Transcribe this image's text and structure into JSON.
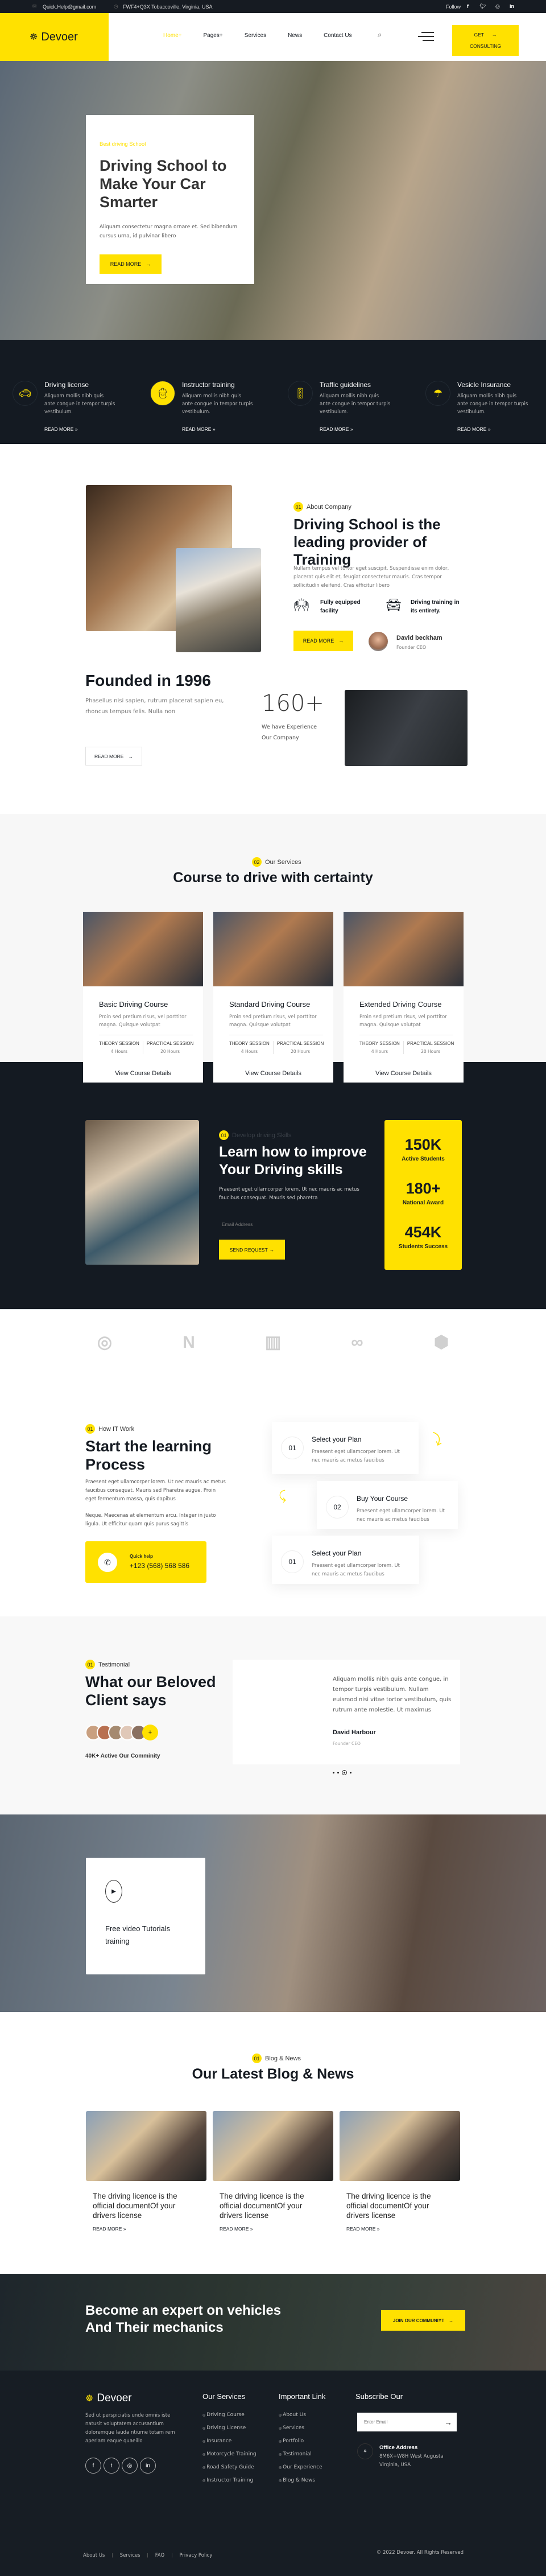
{
  "colors": {
    "accent": "#ffe100",
    "dark": "#141a22"
  },
  "topbar": {
    "email": "Quick.Help@gmail.com",
    "address": "FWF4+Q3X Tobaccoville, Virginia, USA",
    "follow": "Follow",
    "socials": [
      "facebook-icon",
      "twitter-icon",
      "instagram-icon",
      "linkedin-icon"
    ]
  },
  "header": {
    "logo": "Devoer",
    "nav": [
      {
        "label": "Home+",
        "active": true
      },
      {
        "label": "Pages+"
      },
      {
        "label": "Services"
      },
      {
        "label": "News"
      },
      {
        "label": "Contact Us"
      }
    ],
    "cta_line1": "GET",
    "cta_line2": "CONSULTING"
  },
  "hero": {
    "tag": "Best driving School",
    "title": "Driving School to Make Your Car Smarter",
    "text": "Aliquam consectetur magna ornare et. Sed bibendum cursus urna, id pulvinar libero",
    "button": "READ MORE"
  },
  "features": [
    {
      "title": "Driving license",
      "text": "Aliquam mollis nibh quis ante congue in tempor turpis vestibulum.",
      "link": "READ MORE",
      "icon": "car-license-icon"
    },
    {
      "title": "Instructor training",
      "text": "Aliquam mollis nibh quis ante congue in tempor turpis vestibulum.",
      "link": "READ MORE",
      "icon": "instructor-icon",
      "active": true
    },
    {
      "title": "Traffic guidelines",
      "text": "Aliquam mollis nibh quis ante congue in tempor turpis vestibulum.",
      "link": "READ MORE",
      "icon": "traffic-light-icon"
    },
    {
      "title": "Vesicle Insurance",
      "text": "Aliquam mollis nibh quis ante congue in tempor turpis vestibulum.",
      "link": "READ MORE",
      "icon": "insurance-umbrella-icon"
    }
  ],
  "about": {
    "badge_num": "01",
    "badge": "About Company",
    "title": "Driving School is the leading provider of Training",
    "text": "Nullam tempus vel tortor eget suscipit. Suspendisse enim dolor, placerat quis elit et, feugiat consectetur mauris. Cras tempor sollicitudin eleifend. Cras efficitur libero",
    "point1": "Fully equipped facility",
    "point2": "Driving training in its entirety.",
    "button": "READ MORE",
    "founder_name": "David beckham",
    "founder_role": "Founder CEO"
  },
  "founded": {
    "title": "Founded in 1996",
    "text": "Phasellus nisi sapien, rutrum placerat sapien eu, rhoncus tempus felis. Nulla non",
    "button": "READ MORE",
    "stat": "160+",
    "stat_label": "We have Experience Our Company"
  },
  "services": {
    "badge_num": "02",
    "badge": "Our Services",
    "title": "Course to drive with certainty",
    "courses": [
      {
        "title": "Basic Driving Course",
        "text": "Proin sed pretium risus, vel porttitor magna. Quisque volutpat",
        "theory": "THEORY SESSION",
        "theory_val": "4 Hours",
        "practical": "PRACTICAL SESSION",
        "practical_val": "20 Hours",
        "link": "View Course Details"
      },
      {
        "title": "Standard Driving Course",
        "text": "Proin sed pretium risus, vel porttitor magna. Quisque volutpat",
        "theory": "THEORY SESSION",
        "theory_val": "4 Hours",
        "practical": "PRACTICAL SESSION",
        "practical_val": "20 Hours",
        "link": "View Course Details"
      },
      {
        "title": "Extended Driving Course",
        "text": "Proin sed pretium risus, vel porttitor magna. Quisque volutpat",
        "theory": "THEORY SESSION",
        "theory_val": "4 Hours",
        "practical": "PRACTICAL SESSION",
        "practical_val": "20 Hours",
        "link": "View Course Details"
      }
    ]
  },
  "skills": {
    "badge_num": "01",
    "badge": "Develop driving Skills",
    "title": "Learn how to improve Your Driving skills",
    "text": "Praesent eget ullamcorper lorem. Ut nec mauris ac metus faucibus consequat. Mauris sed pharetra",
    "email_placeholder": "Email Address",
    "button": "SEND REQUEST",
    "stats": [
      {
        "value": "150K",
        "label": "Active Students"
      },
      {
        "value": "180+",
        "label": "National Award"
      },
      {
        "value": "454K",
        "label": "Students Success"
      }
    ]
  },
  "how": {
    "badge_num": "01",
    "badge": "How IT Work",
    "title": "Start the learning Process",
    "text1": "Praesent eget ullamcorper lorem. Ut nec mauris ac metus faucibus consequat. Mauris sed Pharetra augue. Proin eget fermentum massa, quis dapibus",
    "text2": "Neque. Maecenas at elementum arcu. Integer in justo ligula. Ut efficitur quam quis purus sagittis",
    "help_label": "Quick help",
    "phone": "+123 (568) 568 586",
    "steps": [
      {
        "num": "01",
        "title": "Select your Plan",
        "text": "Praesent eget ullamcorper lorem. Ut nec mauris ac metus faucibus"
      },
      {
        "num": "02",
        "title": "Buy Your Course",
        "text": "Praesent eget ullamcorper lorem. Ut nec mauris ac metus faucibus"
      },
      {
        "num": "01",
        "title": "Select your Plan",
        "text": "Praesent eget ullamcorper lorem. Ut nec mauris ac metus faucibus"
      }
    ]
  },
  "testimonial": {
    "badge_num": "01",
    "badge": "Testimonial",
    "title": "What our Beloved Client says",
    "community": "40K+ Active Our Comminity",
    "plus": "+",
    "quote": "Aliquam mollis nibh quis ante congue, in tempor turpis vestibulum. Nullam euismod nisi vitae tortor vestibulum, quis rutrum ante molestie. Ut maximus",
    "name": "David Harbour",
    "role": "Founder CEO",
    "slides": 4,
    "active_slide": 3
  },
  "video": {
    "title": "Free video Tutorials training"
  },
  "blog": {
    "badge_num": "01",
    "badge": "Blog & News",
    "title": "Our Latest Blog & News",
    "posts": [
      {
        "title": "The driving licence is the official documentOf your drivers license",
        "link": "READ MORE"
      },
      {
        "title": "The driving licence is the official documentOf your drivers license",
        "link": "READ MORE"
      },
      {
        "title": "The driving licence is the official documentOf your drivers license",
        "link": "READ MORE"
      }
    ]
  },
  "cta": {
    "title": "Become an expert on vehicles And Their mechanics",
    "button": "JOIN OUR COMMUNIYT"
  },
  "footer": {
    "logo": "Devoer",
    "about": "Sed ut perspiciatis unde omnis iste natusit voluptatem accusantium doloremque lauda ntiume totam rem aperiam eaque quaeillo",
    "services_title": "Our Services",
    "services": [
      "Driving Course",
      "Driving License",
      "Insurance",
      "Motorcycle Training",
      "Road Safety Guide",
      "Instructor Training"
    ],
    "links_title": "Important Link",
    "links": [
      "About Us",
      "Services",
      "Portfolio",
      "Testimonial",
      "Our Experience",
      "Blog & News"
    ],
    "subscribe_title": "Subscribe Our",
    "email_placeholder": "Enter Email",
    "office_label": "Office Address",
    "office_address": "8M6X+W8H West Augusta Virginia, USA",
    "bottom_links": [
      "About Us",
      "Services",
      "FAQ",
      "Privacy Policy"
    ],
    "copyright": "© 2022 Devoer. All Rights Reserved"
  }
}
